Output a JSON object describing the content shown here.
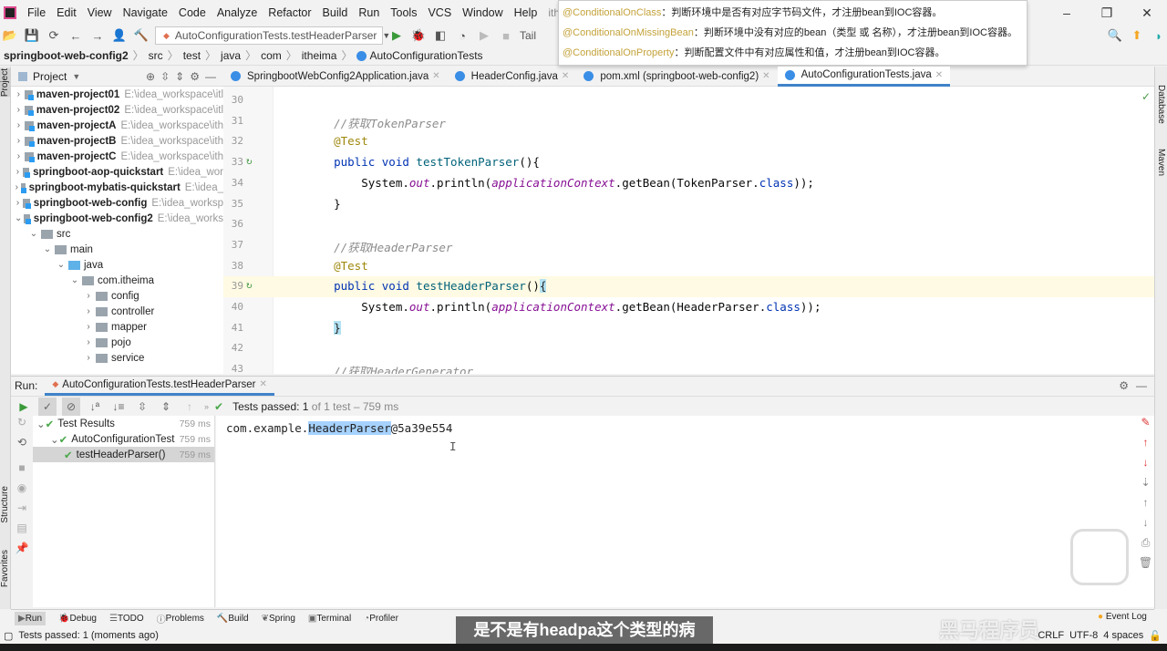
{
  "menubar": {
    "items": [
      "File",
      "Edit",
      "View",
      "Navigate",
      "Code",
      "Analyze",
      "Refactor",
      "Build",
      "Run",
      "Tools",
      "VCS",
      "Window",
      "Help"
    ],
    "title": "itheima_web_pr"
  },
  "toolbar": {
    "run_config": "AutoConfigurationTests.testHeaderParser",
    "tail": "Tail"
  },
  "breadcrumb": [
    "springboot-web-config2",
    "src",
    "test",
    "java",
    "com",
    "itheima",
    "AutoConfigurationTests"
  ],
  "tooltip": [
    {
      "annotation": "@ConditionalOnClass",
      "text": "：判断环境中是否有对应字节码文件，才注册bean到IOC容器。"
    },
    {
      "annotation": "@ConditionalOnMissingBean",
      "text": "：判断环境中没有对应的bean（类型 或 名称），才注册bean到IOC容器。"
    },
    {
      "annotation": "@ConditionalOnProperty",
      "text": "：判断配置文件中有对应属性和值，才注册bean到IOC容器。"
    }
  ],
  "project": {
    "header": "Project",
    "side_label": "Project",
    "tree": [
      {
        "name": "maven-project01",
        "path": "E:\\idea_workspace\\itl",
        "depth": 0,
        "open": false,
        "kind": "module"
      },
      {
        "name": "maven-project02",
        "path": "E:\\idea_workspace\\itl",
        "depth": 0,
        "open": false,
        "kind": "module"
      },
      {
        "name": "maven-projectA",
        "path": "E:\\idea_workspace\\ith",
        "depth": 0,
        "open": false,
        "kind": "module"
      },
      {
        "name": "maven-projectB",
        "path": "E:\\idea_workspace\\ith",
        "depth": 0,
        "open": false,
        "kind": "module"
      },
      {
        "name": "maven-projectC",
        "path": "E:\\idea_workspace\\ith",
        "depth": 0,
        "open": false,
        "kind": "module"
      },
      {
        "name": "springboot-aop-quickstart",
        "path": "E:\\idea_wor",
        "depth": 0,
        "open": false,
        "kind": "module"
      },
      {
        "name": "springboot-mybatis-quickstart",
        "path": "E:\\idea_",
        "depth": 0,
        "open": false,
        "kind": "module"
      },
      {
        "name": "springboot-web-config",
        "path": "E:\\idea_worksp",
        "depth": 0,
        "open": false,
        "kind": "module"
      },
      {
        "name": "springboot-web-config2",
        "path": "E:\\idea_works",
        "depth": 0,
        "open": true,
        "kind": "module"
      },
      {
        "name": "src",
        "path": "",
        "depth": 1,
        "open": true,
        "kind": "folder"
      },
      {
        "name": "main",
        "path": "",
        "depth": 2,
        "open": true,
        "kind": "folder"
      },
      {
        "name": "java",
        "path": "",
        "depth": 3,
        "open": true,
        "kind": "java"
      },
      {
        "name": "com.itheima",
        "path": "",
        "depth": 4,
        "open": true,
        "kind": "folder"
      },
      {
        "name": "config",
        "path": "",
        "depth": 5,
        "open": false,
        "kind": "folder"
      },
      {
        "name": "controller",
        "path": "",
        "depth": 5,
        "open": false,
        "kind": "folder"
      },
      {
        "name": "mapper",
        "path": "",
        "depth": 5,
        "open": false,
        "kind": "folder"
      },
      {
        "name": "pojo",
        "path": "",
        "depth": 5,
        "open": false,
        "kind": "folder"
      },
      {
        "name": "service",
        "path": "",
        "depth": 5,
        "open": false,
        "kind": "folder"
      }
    ]
  },
  "tabs": [
    {
      "label": "SpringbootWebConfig2Application.java",
      "active": false
    },
    {
      "label": "HeaderConfig.java",
      "active": false
    },
    {
      "label": "pom.xml (springboot-web-config2)",
      "active": false
    },
    {
      "label": "AutoConfigurationTests.java",
      "active": true
    }
  ],
  "editor": {
    "lines": [
      {
        "n": "30",
        "tokens": []
      },
      {
        "n": "31",
        "tokens": [
          {
            "t": "cm",
            "v": "    //获取TokenParser"
          }
        ]
      },
      {
        "n": "32",
        "tokens": [
          {
            "t": "an",
            "v": "    @Test"
          }
        ]
      },
      {
        "n": "33",
        "run": true,
        "tokens": [
          {
            "t": "kw",
            "v": "    public void "
          },
          {
            "t": "fn",
            "v": "testTokenParser"
          },
          {
            "t": "pl",
            "v": "(){"
          }
        ]
      },
      {
        "n": "34",
        "tokens": [
          {
            "t": "pl",
            "v": "        System."
          },
          {
            "t": "st",
            "v": "out"
          },
          {
            "t": "pl",
            "v": ".println("
          },
          {
            "t": "st",
            "v": "applicationContext"
          },
          {
            "t": "pl",
            "v": ".getBean(TokenParser."
          },
          {
            "t": "kw",
            "v": "class"
          },
          {
            "t": "pl",
            "v": "));"
          }
        ]
      },
      {
        "n": "35",
        "tokens": [
          {
            "t": "pl",
            "v": "    }"
          }
        ]
      },
      {
        "n": "36",
        "tokens": []
      },
      {
        "n": "37",
        "tokens": [
          {
            "t": "cm",
            "v": "    //获取HeaderParser"
          }
        ]
      },
      {
        "n": "38",
        "tokens": [
          {
            "t": "an",
            "v": "    @Test"
          }
        ]
      },
      {
        "n": "39",
        "run": true,
        "current": true,
        "tokens": [
          {
            "t": "kw",
            "v": "    public void "
          },
          {
            "t": "fn",
            "v": "testHeaderParser"
          },
          {
            "t": "pl",
            "v": "()"
          },
          {
            "t": "br",
            "v": "{"
          }
        ]
      },
      {
        "n": "40",
        "tokens": [
          {
            "t": "pl",
            "v": "        System."
          },
          {
            "t": "st",
            "v": "out"
          },
          {
            "t": "pl",
            "v": ".println("
          },
          {
            "t": "st",
            "v": "applicationContext"
          },
          {
            "t": "pl",
            "v": ".getBean(HeaderParser."
          },
          {
            "t": "kw",
            "v": "class"
          },
          {
            "t": "pl",
            "v": "));"
          }
        ]
      },
      {
        "n": "41",
        "tokens": [
          {
            "t": "pl",
            "v": "    "
          },
          {
            "t": "br",
            "v": "}"
          }
        ]
      },
      {
        "n": "42",
        "tokens": []
      },
      {
        "n": "43",
        "tokens": [
          {
            "t": "cm",
            "v": "    //获取HeaderGenerator"
          }
        ]
      }
    ]
  },
  "run": {
    "label": "Run:",
    "tab": "AutoConfigurationTests.testHeaderParser",
    "status_bold": "Tests passed: 1",
    "status_rest": " of 1 test – 759 ms",
    "results": [
      {
        "name": "Test Results",
        "ms": "759 ms",
        "depth": 0
      },
      {
        "name": "AutoConfigurationTest",
        "ms": "759 ms",
        "depth": 1
      },
      {
        "name": "testHeaderParser()",
        "ms": "759 ms",
        "depth": 2,
        "selected": true
      }
    ],
    "console": {
      "prefix": "com.example.",
      "highlight": "HeaderParser",
      "suffix": "@5a39e554"
    }
  },
  "tool_windows": [
    "Run",
    "Debug",
    "TODO",
    "Problems",
    "Build",
    "Spring",
    "Terminal",
    "Profiler"
  ],
  "event_log": "Event Log",
  "status": {
    "message": "Tests passed: 1 (moments ago)",
    "line_sep": "CRLF",
    "encoding": "UTF-8",
    "indent": "4 spaces"
  },
  "right_strip": [
    "Database",
    "Maven"
  ],
  "left_strip": [
    "Structure",
    "Favorites"
  ],
  "subtitle": "是不是有headpa这个类型的病",
  "watermark": "黑马程序员"
}
